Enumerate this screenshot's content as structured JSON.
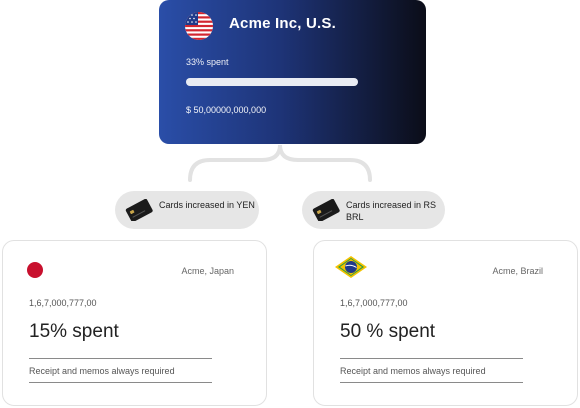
{
  "parent": {
    "title": "Acme Inc, U.S.",
    "spent_label": "33% spent",
    "spent_fraction": 0.33,
    "amount": "$ 50,00000,000,000",
    "flag_icon": "us-flag-icon",
    "gradient": [
      "#2a4ea8",
      "#0b0d18"
    ]
  },
  "pills": [
    {
      "text": "Cards increased in YEN",
      "icon": "credit-card-icon"
    },
    {
      "text": "Cards increased in RS BRL",
      "icon": "credit-card-icon"
    }
  ],
  "children": [
    {
      "name": "Acme, Japan",
      "number": "1,6,7,000,777,00",
      "spent": "15% spent",
      "note": "Receipt and memos always required",
      "flag_icon": "japan-flag-icon"
    },
    {
      "name": "Acme, Brazil",
      "number": "1,6,7,000,777,00",
      "spent": "50 % spent",
      "note": "Receipt and memos always required",
      "flag_icon": "brazil-flag-icon"
    }
  ]
}
